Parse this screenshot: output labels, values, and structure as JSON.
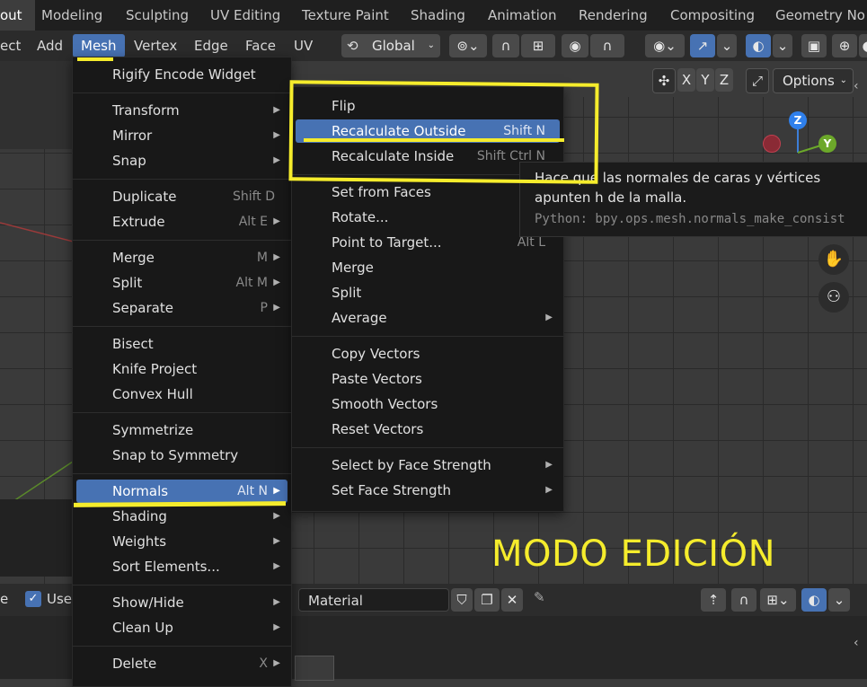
{
  "workspace_tabs": [
    "out",
    "Modeling",
    "Sculpting",
    "UV Editing",
    "Texture Paint",
    "Shading",
    "Animation",
    "Rendering",
    "Compositing",
    "Geometry No"
  ],
  "header_menus": [
    "ect",
    "Add",
    "Mesh",
    "Vertex",
    "Edge",
    "Face",
    "UV"
  ],
  "header_tools": {
    "transform_orientation": "Global",
    "options_label": "Options",
    "axes": [
      "X",
      "Y",
      "Z"
    ]
  },
  "gizmo": {
    "z": "Z",
    "y": "Y"
  },
  "mesh_menu": {
    "items": [
      {
        "label": "Rigify Encode Widget",
        "shortcut": "",
        "submenu": false
      },
      {
        "label": "Transform",
        "shortcut": "",
        "submenu": true
      },
      {
        "label": "Mirror",
        "shortcut": "",
        "submenu": true
      },
      {
        "label": "Snap",
        "shortcut": "",
        "submenu": true
      },
      {
        "label": "Duplicate",
        "shortcut": "Shift D",
        "submenu": false
      },
      {
        "label": "Extrude",
        "shortcut": "Alt E",
        "submenu": true
      },
      {
        "label": "Merge",
        "shortcut": "M",
        "submenu": true
      },
      {
        "label": "Split",
        "shortcut": "Alt M",
        "submenu": true
      },
      {
        "label": "Separate",
        "shortcut": "P",
        "submenu": true
      },
      {
        "label": "Bisect",
        "shortcut": "",
        "submenu": false
      },
      {
        "label": "Knife Project",
        "shortcut": "",
        "submenu": false
      },
      {
        "label": "Convex Hull",
        "shortcut": "",
        "submenu": false
      },
      {
        "label": "Symmetrize",
        "shortcut": "",
        "submenu": false
      },
      {
        "label": "Snap to Symmetry",
        "shortcut": "",
        "submenu": false
      },
      {
        "label": "Normals",
        "shortcut": "Alt N",
        "submenu": true
      },
      {
        "label": "Shading",
        "shortcut": "",
        "submenu": true
      },
      {
        "label": "Weights",
        "shortcut": "",
        "submenu": true
      },
      {
        "label": "Sort Elements...",
        "shortcut": "",
        "submenu": true
      },
      {
        "label": "Show/Hide",
        "shortcut": "",
        "submenu": true
      },
      {
        "label": "Clean Up",
        "shortcut": "",
        "submenu": true
      },
      {
        "label": "Delete",
        "shortcut": "X",
        "submenu": true
      }
    ]
  },
  "normals_menu": {
    "items": [
      {
        "label": "Flip",
        "shortcut": "",
        "submenu": false
      },
      {
        "label": "Recalculate Outside",
        "shortcut": "Shift N",
        "submenu": false
      },
      {
        "label": "Recalculate Inside",
        "shortcut": "Shift Ctrl N",
        "submenu": false
      },
      {
        "label": "Set from Faces",
        "shortcut": "",
        "submenu": false
      },
      {
        "label": "Rotate...",
        "shortcut": "",
        "submenu": false
      },
      {
        "label": "Point to Target...",
        "shortcut": "Alt L",
        "submenu": false
      },
      {
        "label": "Merge",
        "shortcut": "",
        "submenu": false
      },
      {
        "label": "Split",
        "shortcut": "",
        "submenu": false
      },
      {
        "label": "Average",
        "shortcut": "",
        "submenu": true
      },
      {
        "label": "Copy Vectors",
        "shortcut": "",
        "submenu": false
      },
      {
        "label": "Paste Vectors",
        "shortcut": "",
        "submenu": false
      },
      {
        "label": "Smooth Vectors",
        "shortcut": "",
        "submenu": false
      },
      {
        "label": "Reset Vectors",
        "shortcut": "",
        "submenu": false
      },
      {
        "label": "Select by Face Strength",
        "shortcut": "",
        "submenu": true
      },
      {
        "label": "Set Face Strength",
        "shortcut": "",
        "submenu": true
      }
    ]
  },
  "tooltip": {
    "description": "Hace que las normales de caras y vértices apunten h de la malla.",
    "python": "Python: bpy.ops.mesh.normals_make_consist"
  },
  "annotation_label": "MODO EDICIÓN",
  "bottom_bar": {
    "use_label": "Use",
    "left_fragment": "e",
    "material_label": "Material"
  },
  "colors": {
    "accent": "#4772b3",
    "annotation": "#f5ec2c"
  }
}
